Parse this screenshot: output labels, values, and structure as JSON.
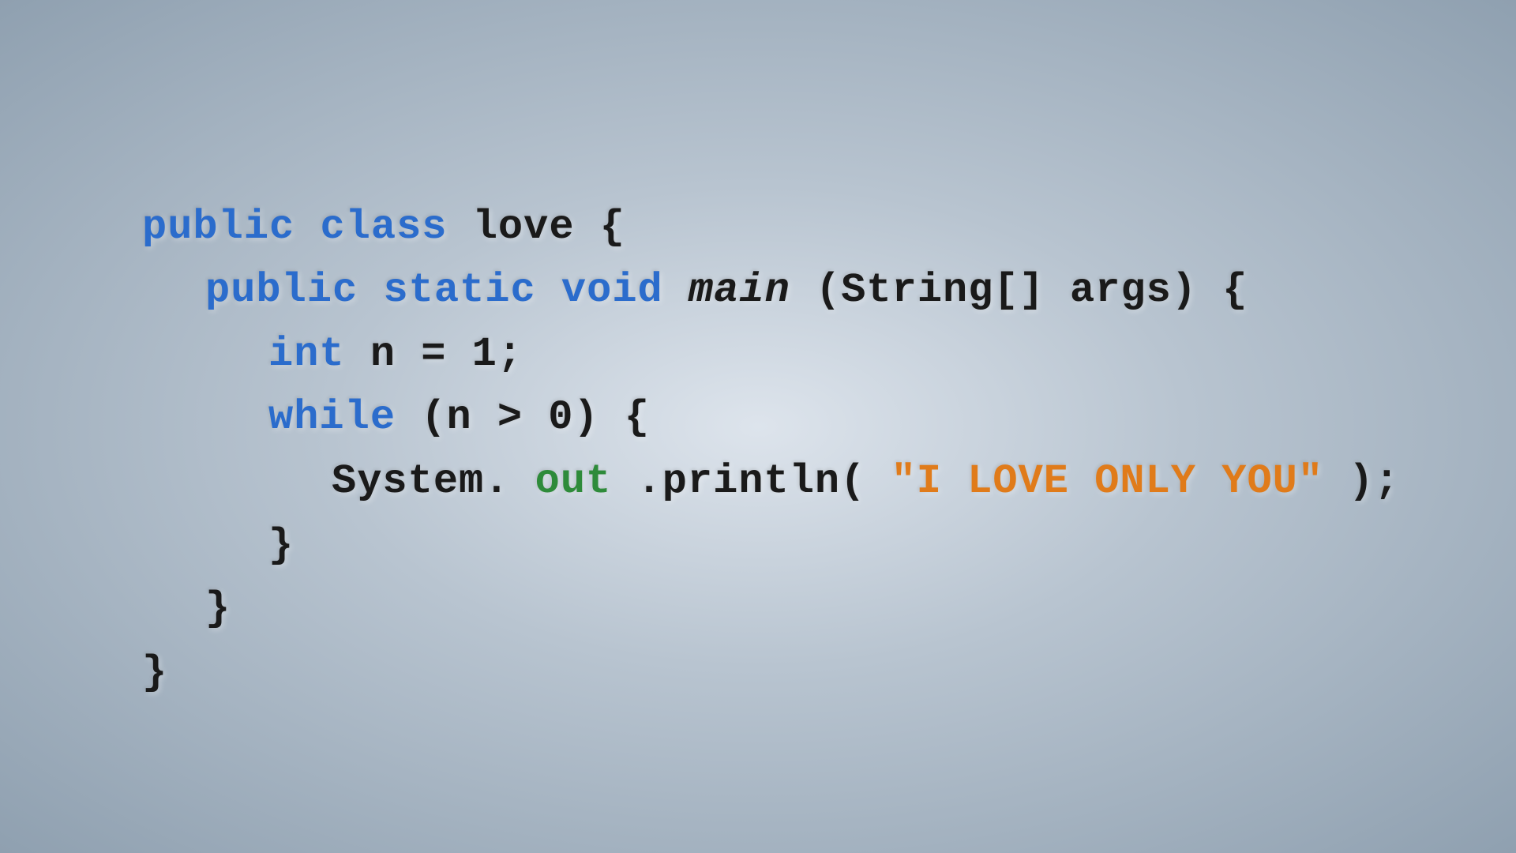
{
  "background": {
    "gradient": "radial-gradient(ellipse at center, #dde4ec 0%, #b8c4d0 40%, #8fa0b0 100%)"
  },
  "code": {
    "line1": {
      "keyword1": "public",
      "keyword2": "class",
      "rest": " love {"
    },
    "line2": {
      "keyword1": "public",
      "keyword2": "static",
      "keyword3": "void",
      "method": "main",
      "rest": "(String[] args) {"
    },
    "line3": {
      "keyword": "int",
      "rest": " n = 1;"
    },
    "line4": {
      "keyword": "while",
      "rest": " (n > 0) {"
    },
    "line5": {
      "prefix": "System.",
      "green": "out",
      "middle": ".println(",
      "string": "\"I LOVE ONLY YOU\"",
      "suffix": ");"
    },
    "line6": "}",
    "line7": "}",
    "line8": "}"
  }
}
